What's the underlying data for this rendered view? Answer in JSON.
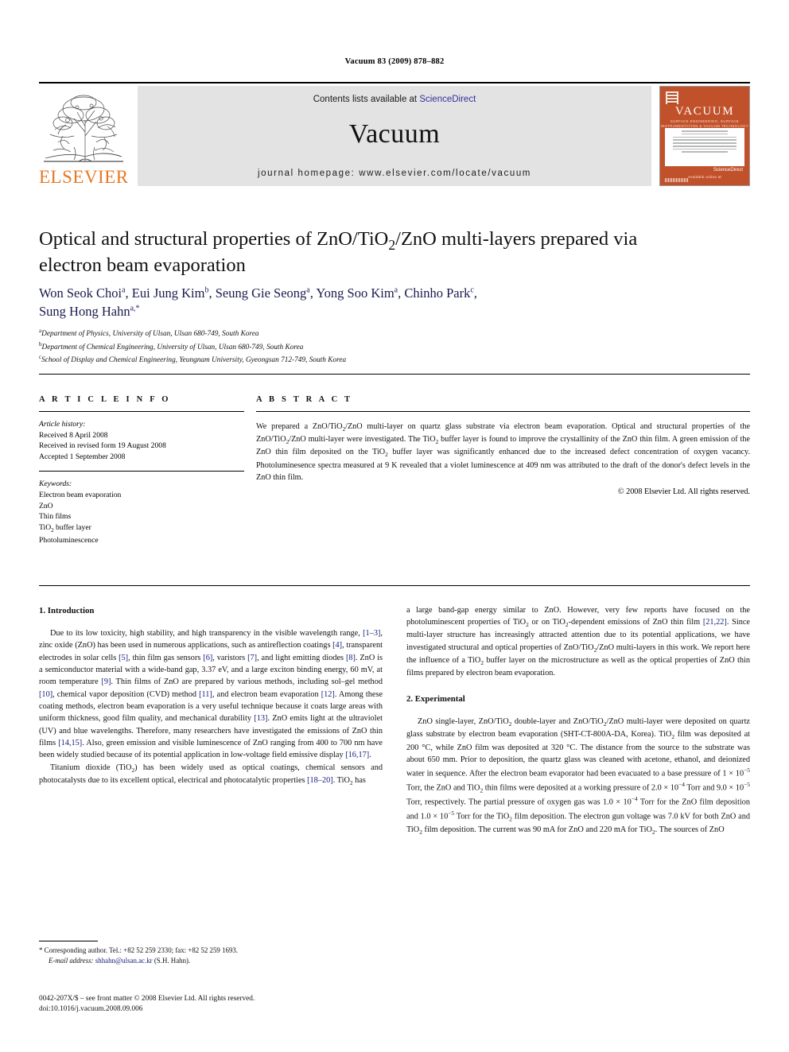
{
  "running_head": "Vacuum 83 (2009) 878–882",
  "masthead": {
    "publisher_logo_text": "ELSEVIER",
    "contents_prefix": "Contents lists available at ",
    "contents_link": "ScienceDirect",
    "journal_title": "Vacuum",
    "homepage": "journal homepage: www.elsevier.com/locate/vacuum",
    "cover": {
      "title": "VACUUM",
      "subtitle": "SURFACE ENGINEERING, SURFACE INSTRUMENTATION & VACUUM TECHNOLOGY",
      "footer": "Available online at",
      "footer_brand": "ScienceDirect"
    },
    "accent_orange": "#e87722",
    "cover_orange": "#c0512a",
    "link_blue": "#32329b"
  },
  "article": {
    "title_line1": "Optical and structural properties of ZnO/TiO",
    "title_sub1": "2",
    "title_line1b": "/ZnO multi-layers prepared via",
    "title_line2": "electron beam evaporation",
    "authors": [
      {
        "name": "Won Seok Choi",
        "mark": "a",
        "sep": ", "
      },
      {
        "name": "Eui Jung Kim",
        "mark": "b",
        "sep": ", "
      },
      {
        "name": "Seung Gie Seong",
        "mark": "a",
        "sep": ", "
      },
      {
        "name": "Yong Soo Kim",
        "mark": "a",
        "sep": ", "
      },
      {
        "name": "Chinho Park",
        "mark": "c",
        "sep": ","
      },
      {
        "name": "Sung Hong Hahn",
        "mark": "a,*",
        "sep": ""
      }
    ],
    "affiliations": [
      {
        "mark": "a",
        "text": "Department of Physics, University of Ulsan, Ulsan 680-749, South Korea"
      },
      {
        "mark": "b",
        "text": "Department of Chemical Engineering, University of Ulsan, Ulsan 680-749, South Korea"
      },
      {
        "mark": "c",
        "text": "School of Display and Chemical Engineering, Yeungnam University, Gyeongsan 712-749, South Korea"
      }
    ]
  },
  "article_info": {
    "heading": "A R T I C L E  I N F O",
    "history_label": "Article history:",
    "history": [
      "Received 8 April 2008",
      "Received in revised form 19 August 2008",
      "Accepted 1 September 2008"
    ],
    "keywords_label": "Keywords:",
    "keywords": [
      "Electron beam evaporation",
      "ZnO",
      "Thin films",
      "TiO2 buffer layer",
      "Photoluminescence"
    ]
  },
  "abstract": {
    "heading": "A B S T R A C T",
    "text": "We prepared a ZnO/TiO2/ZnO multi-layer on quartz glass substrate via electron beam evaporation. Optical and structural properties of the ZnO/TiO2/ZnO multi-layer were investigated. The TiO2 buffer layer is found to improve the crystallinity of the ZnO thin film. A green emission of the ZnO thin film deposited on the TiO2 buffer layer was significantly enhanced due to the increased defect concentration of oxygen vacancy. Photoluminesence spectra measured at 9 K revealed that a violet luminescence at 409 nm was attributed to the draft of the donor's defect levels in the ZnO thin film.",
    "copyright": "© 2008 Elsevier Ltd. All rights reserved."
  },
  "body": {
    "section1_heading": "1. Introduction",
    "section1_para1": "Due to its low toxicity, high stability, and high transparency in the visible wavelength range, [1–3], zinc oxide (ZnO) has been used in numerous applications, such as antireflection coatings [4], transparent electrodes in solar cells [5], thin film gas sensors [6], varistors [7], and light emitting diodes [8]. ZnO is a semiconductor material with a wide-band gap, 3.37 eV, and a large exciton binding energy, 60 mV, at room temperature [9]. Thin films of ZnO are prepared by various methods, including sol–gel method [10], chemical vapor deposition (CVD) method [11], and electron beam evaporation [12]. Among these coating methods, electron beam evaporation is a very useful technique because it coats large areas with uniform thickness, good film quality, and mechanical durability [13]. ZnO emits light at the ultraviolet (UV) and blue wavelengths. Therefore, many researchers have investigated the emissions of ZnO thin films [14,15]. Also, green emission and visible luminescence of ZnO ranging from 400 to 700 nm have been widely studied because of its potential application in low-voltage field emissive display [16,17].",
    "section1_para2": "Titanium dioxide (TiO2) has been widely used as optical coatings, chemical sensors and photocatalysts due to its excellent optical, electrical and photocatalytic properties [18–20]. TiO2 has",
    "section1_para3": "a large band-gap energy similar to ZnO. However, very few reports have focused on the photoluminescent properties of TiO2 or on TiO2-dependent emissions of ZnO thin film [21,22]. Since multi-layer structure has increasingly attracted attention due to its potential applications, we have investigated structural and optical properties of ZnO/TiO2/ZnO multi-layers in this work. We report here the influence of a TiO2 buffer layer on the microstructure as well as the optical properties of ZnO thin films prepared by electron beam evaporation.",
    "section2_heading": "2. Experimental",
    "section2_para1": "ZnO single-layer, ZnO/TiO2 double-layer and ZnO/TiO2/ZnO multi-layer were deposited on quartz glass substrate by electron beam evaporation (SHT-CT-800A-DA, Korea). TiO2 film was deposited at 200 °C, while ZnO film was deposited at 320 °C. The distance from the source to the substrate was about 650 mm. Prior to deposition, the quartz glass was cleaned with acetone, ethanol, and deionized water in sequence. After the electron beam evaporator had been evacuated to a base pressure of 1 × 10−5 Torr, the ZnO and TiO2 thin films were deposited at a working pressure of 2.0 × 10−4 Torr and 9.0 × 10−5 Torr, respectively. The partial pressure of oxygen gas was 1.0 × 10−4 Torr for the ZnO film deposition and 1.0 × 10−5 Torr for the TiO2 film deposition. The electron gun voltage was 7.0 kV for both ZnO and TiO2 film deposition. The current was 90 mA for ZnO and 220 mA for TiO2. The sources of ZnO"
  },
  "footnote": {
    "corresponding": "* Corresponding author. Tel.: +82 52 259 2330; fax: +82 52 259 1693.",
    "email_label": "E-mail address:",
    "email": "shhahn@ulsan.ac.kr",
    "email_suffix": "(S.H. Hahn).",
    "imprint_line1": "0042-207X/$ – see front matter © 2008 Elsevier Ltd. All rights reserved.",
    "imprint_line2": "doi:10.1016/j.vacuum.2008.09.006"
  }
}
